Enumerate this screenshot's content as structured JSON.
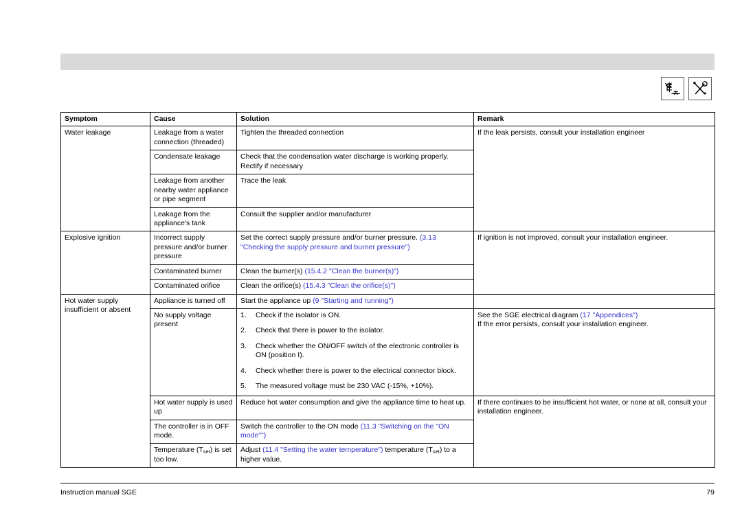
{
  "document": {
    "footer_left": "Instruction manual SGE",
    "page_number": "79"
  },
  "header": {
    "icons": [
      {
        "name": "piping-diagram-icon",
        "title": "Piping / gas installation"
      },
      {
        "name": "tools-icon",
        "title": "Service tools"
      }
    ]
  },
  "colors": {
    "link": "#3333cc",
    "header_bar": "#d9d9d9",
    "border": "#000000"
  },
  "table": {
    "columns": [
      "Symptom",
      "Cause",
      "Solution",
      "Remark"
    ],
    "rows": [
      {
        "symptom": "Water leakage",
        "cause": "Leakage from a water connection (threaded)",
        "solution": "Tighten the threaded connection",
        "remark": "If the leak persists, consult your installation engineer"
      },
      {
        "symptom": "",
        "cause": "Condensate leakage",
        "solution": "Check that the condensation water discharge is working properly. Rectify if necessary",
        "remark": ""
      },
      {
        "symptom": "",
        "cause": "Leakage from another nearby water appliance or pipe segment",
        "solution": "Trace the leak",
        "remark": ""
      },
      {
        "symptom": "",
        "cause": "Leakage from the appliance's tank",
        "solution": "Consult the supplier and/or manufacturer",
        "remark": ""
      },
      {
        "symptom": "Explosive ignition",
        "cause": "Incorrect supply pressure and/or burner pressure",
        "solution_text": "Set the correct supply pressure and/or burner pressure. ",
        "solution_link": "(3.13 \"Checking the supply pressure and burner pressure\")",
        "remark": "If ignition is not improved, consult your installation engineer."
      },
      {
        "symptom": "",
        "cause": "Contaminated burner",
        "solution_text": "Clean the burner(s) ",
        "solution_link": "(15.4.2 \"Clean the burner(s)\")",
        "remark": ""
      },
      {
        "symptom": "",
        "cause": "Contaminated orifice",
        "solution_text": "Clean the orifice(s) ",
        "solution_link": "(15.4.3 \"Clean the orifice(s)\")",
        "remark": ""
      },
      {
        "symptom": "Hot water supply insufficient or absent",
        "cause": "Appliance is turned off",
        "solution_text": "Start the appliance up ",
        "solution_link": "(9 \"Starting and running\")",
        "remark": ""
      },
      {
        "symptom": "",
        "cause": "No supply voltage present",
        "solution_steps": [
          "Check if the isolator is ON.",
          "Check that there is power to the isolator.",
          "Check whether the ON/OFF switch of the electronic controller is ON (position I).",
          "Check whether there is power to the electrical connector block.",
          "The measured voltage must be 230 VAC (-15%, +10%)."
        ],
        "remark_text": "See the SGE electrical diagram ",
        "remark_link": "(17 \"Appendices\")",
        "remark_text2": "If the error persists, consult your installation engineer."
      },
      {
        "symptom": "",
        "cause": "Hot water supply is used up",
        "solution": "Reduce hot water consumption and give the appliance time to heat up.",
        "remark": "If there continues to be insufficient hot water, or none at all, consult your installation engineer."
      },
      {
        "symptom": "",
        "cause": "The controller is in OFF mode.",
        "solution_text": "Switch the controller to the ON mode ",
        "solution_link": "(11.3 \"Switching on the \"ON mode\"\")",
        "remark": ""
      },
      {
        "symptom": "",
        "cause_pre": "Temperature (T",
        "cause_sub": "set",
        "cause_post": ") is set too low.",
        "solution_pre": "Adjust ",
        "solution_link": "(11.4 \"Setting the water temperature\")",
        "solution_mid": " temperature (T",
        "solution_sub": "set",
        "solution_post": ") to a higher value.",
        "remark": ""
      }
    ]
  }
}
